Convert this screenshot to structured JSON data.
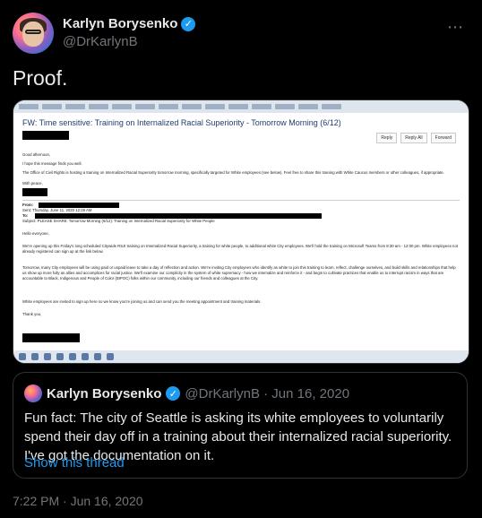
{
  "author": {
    "name": "Karlyn Borysenko",
    "handle": "@DrKarlynB",
    "verified_icon": "verified-badge-icon"
  },
  "more_icon": "⋯",
  "tweet": {
    "text": "Proof.",
    "timestamp": "7:22 PM · Jun 16, 2020"
  },
  "email": {
    "subject": "FW: Time sensitive: Training on Internalized Racial Superiority - Tomorrow Morning (6/12)",
    "actions": [
      "Reply",
      "Reply All",
      "Forward"
    ],
    "lines": [
      "Good afternoon,",
      "I hope this message finds you well.",
      "The Office of Civil Rights is hosting a training on Internalized Racial Superiority tomorrow morning, specifically targeted for White employees (see below). Feel free to share this training with White Caucus members or other colleagues, if appropriate.",
      "With peace,",
      "From:",
      "Sent: Thursday, June 11, 2020 12:29 AM",
      "To:",
      "Subject: PLEASE SHARE: Tomorrow Morning (6/12): Training on Internalized Racial Superiority for White People",
      "Hello everyone,",
      "We're opening up this Friday's long scheduled Citywide RSJI training on Internalized Racial Superiority, a training for white people, to additional white City employees. We'll hold the training on Microsoft Teams from 8:30 am - 12:00 pm. White employees not already registered can sign up at the link below.",
      "Tomorrow, many City employees will be using paid or unpaid leave to take a day of reflection and action. We're inviting City employees who identify as white to join this training to learn, reflect, challenge ourselves, and build skills and relationships that help us show up more fully as allies and accomplices for racial justice. We'll examine our complicity in the system of white supremacy - how we internalize and reinforce it - and begin to cultivate practices that enable us to interrupt racism in ways that are accountable to Black, Indigenous and People of Color (BIPOC) folks within our community, including our friends and colleagues at the City.",
      "White employees are invited to sign up here so we know you're joining us and can send you the meeting appointment and training materials.",
      "Thank you,"
    ]
  },
  "quoted_tweet": {
    "name": "Karlyn Borysenko",
    "handle": "@DrKarlynB · Jun 16, 2020",
    "text": "Fun fact: The city of Seattle is asking its white employees to voluntarily spend their day off in a training about their internalized racial superiority. I've got the documentation on it.",
    "link": "Show this thread"
  },
  "colors": {
    "background": "#000000",
    "accent": "#1d9bf0",
    "muted": "#71767b",
    "text": "#e7e9ea"
  }
}
